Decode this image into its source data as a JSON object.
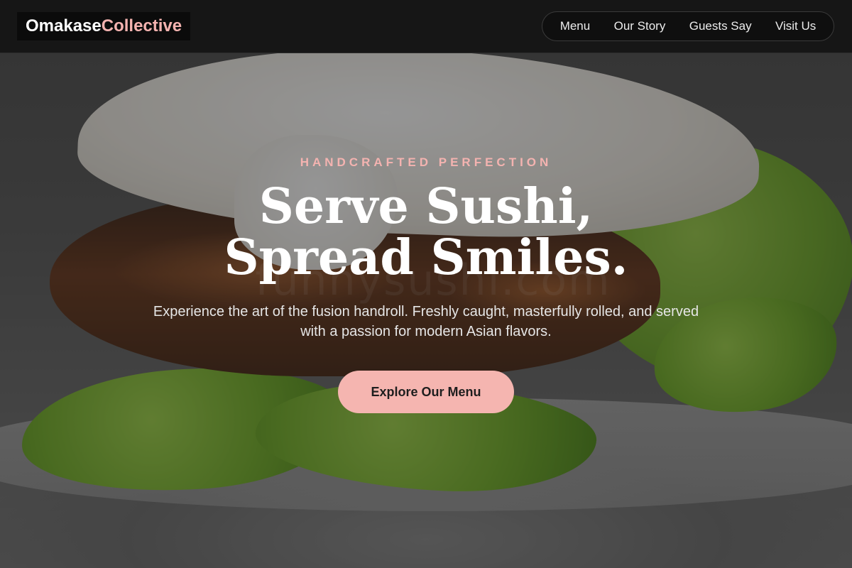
{
  "brand": {
    "part1": "Omakase",
    "part2": "Collective",
    "accent_color": "#f4b3b0"
  },
  "nav": {
    "items": [
      "Menu",
      "Our Story",
      "Guests Say",
      "Visit Us"
    ]
  },
  "hero": {
    "eyebrow": "HANDCRAFTED PERFECTION",
    "headline_line1": "Serve Sushi,",
    "headline_line2": "Spread Smiles.",
    "subtitle": "Experience the art of the fusion handroll. Freshly caught, masterfully rolled, and served with a passion for modern Asian flavors.",
    "cta_label": "Explore Our Menu",
    "cta_color": "#f5b5b0",
    "background_watermark": "funnysushi.com"
  }
}
